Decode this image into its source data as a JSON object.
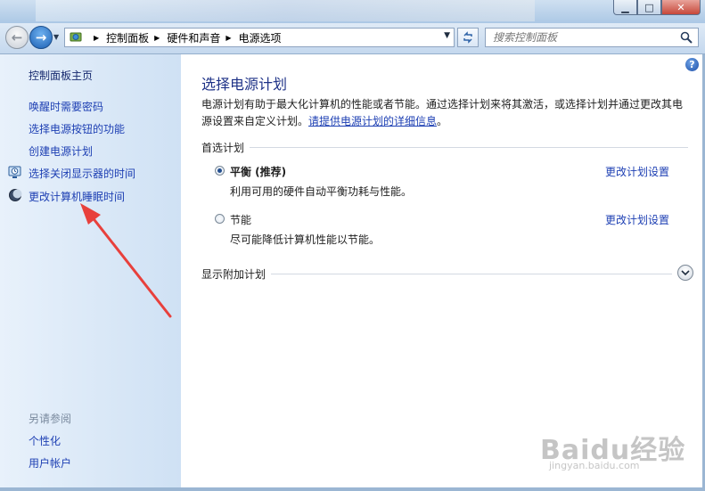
{
  "window": {
    "minimize_glyph": "▁",
    "maximize_glyph": "□",
    "close_glyph": "✕"
  },
  "navbar": {
    "back_glyph": "←",
    "forward_glyph": "→",
    "breadcrumbs": [
      "控制面板",
      "硬件和声音",
      "电源选项"
    ],
    "search_placeholder": "搜索控制面板"
  },
  "sidebar": {
    "home": "控制面板主页",
    "links": [
      {
        "label": "唤醒时需要密码",
        "icon": ""
      },
      {
        "label": "选择电源按钮的功能",
        "icon": ""
      },
      {
        "label": "创建电源计划",
        "icon": ""
      },
      {
        "label": "选择关闭显示器的时间",
        "icon": "monitor-clock-icon"
      },
      {
        "label": "更改计算机睡眠时间",
        "icon": "moon-icon"
      }
    ],
    "see_also_title": "另请参阅",
    "see_also": [
      "个性化",
      "用户帐户"
    ]
  },
  "main": {
    "title": "选择电源计划",
    "intro_text": "电源计划有助于最大化计算机的性能或者节能。通过选择计划来将其激活，或选择计划并通过更改其电源设置来自定义计划。",
    "intro_link": "请提供电源计划的详细信息",
    "intro_end": "。",
    "preferred_label": "首选计划",
    "plans": [
      {
        "name": "平衡 (推荐)",
        "description": "利用可用的硬件自动平衡功耗与性能。",
        "selected": true,
        "link": "更改计划设置"
      },
      {
        "name": "节能",
        "description": "尽可能降低计算机性能以节能。",
        "selected": false,
        "link": "更改计划设置"
      }
    ],
    "additional_label": "显示附加计划"
  },
  "watermark": {
    "logo": "Baidu经验",
    "url": "jingyan.baidu.com"
  },
  "colors": {
    "link": "#1d3fb3",
    "title": "#1e3287",
    "annotation_arrow": "#e8403c"
  }
}
